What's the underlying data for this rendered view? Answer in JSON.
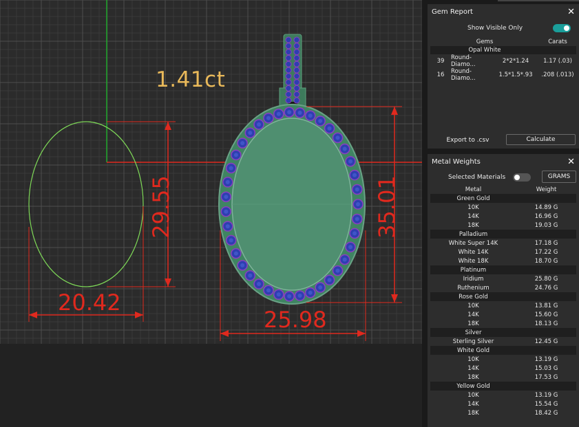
{
  "viewport": {
    "carat_label": "1.41ct",
    "dimensions": {
      "width_left": "20.42",
      "height_left": "29.55",
      "width_right": "25.98",
      "height_right": "35.01"
    }
  },
  "gem_report": {
    "title": "Gem Report",
    "close": "✕",
    "show_visible_label": "Show Visible Only",
    "show_visible_on": true,
    "columns": {
      "gems": "Gems",
      "carats": "Carats"
    },
    "group": "Opal White",
    "rows": [
      {
        "count": "39",
        "name": "Round-Diamo...",
        "size": "2*2*1.24",
        "carats": "1.17 (.03)"
      },
      {
        "count": "16",
        "name": "Round-Diamo...",
        "size": "1.5*1.5*.93",
        "carats": ".208 (.013)"
      }
    ],
    "export_label": "Export to .csv",
    "calculate_label": "Calculate"
  },
  "metal_weights": {
    "title": "Metal Weights",
    "close": "✕",
    "selected_materials_label": "Selected Materials",
    "selected_materials_on": false,
    "units_label": "GRAMS",
    "columns": {
      "metal": "Metal",
      "weight": "Weight"
    },
    "groups": [
      {
        "name": "Green Gold",
        "items": [
          {
            "metal": "10K",
            "weight": "14.89 G"
          },
          {
            "metal": "14K",
            "weight": "16.96 G"
          },
          {
            "metal": "18K",
            "weight": "19.03 G"
          }
        ]
      },
      {
        "name": "Palladium",
        "items": [
          {
            "metal": "White Super 14K",
            "weight": "17.18 G"
          },
          {
            "metal": "White 14K",
            "weight": "17.22 G"
          },
          {
            "metal": "White 18K",
            "weight": "18.70 G"
          }
        ]
      },
      {
        "name": "Platinum",
        "items": [
          {
            "metal": "Iridium",
            "weight": "25.80 G"
          },
          {
            "metal": "Ruthenium",
            "weight": "24.76 G"
          }
        ]
      },
      {
        "name": "Rose Gold",
        "items": [
          {
            "metal": "10K",
            "weight": "13.81 G"
          },
          {
            "metal": "14K",
            "weight": "15.60 G"
          },
          {
            "metal": "18K",
            "weight": "18.13 G"
          }
        ]
      },
      {
        "name": "Silver",
        "items": [
          {
            "metal": "Sterling Silver",
            "weight": "12.45 G"
          }
        ]
      },
      {
        "name": "White Gold",
        "items": [
          {
            "metal": "10K",
            "weight": "13.19 G"
          },
          {
            "metal": "14K",
            "weight": "15.03 G"
          },
          {
            "metal": "18K",
            "weight": "17.53 G"
          }
        ]
      },
      {
        "name": "Yellow Gold",
        "items": [
          {
            "metal": "10K",
            "weight": "13.19 G"
          },
          {
            "metal": "14K",
            "weight": "15.54 G"
          },
          {
            "metal": "18K",
            "weight": "18.42 G"
          }
        ]
      }
    ]
  },
  "colors": {
    "dimension": "#e0291e",
    "carat_label": "#e9b95a",
    "toggle_on": "#1a9e9a",
    "toggle_off": "#555555",
    "outline": "#7ed957",
    "pendant_fill": "#4f8f70",
    "gem_blue": "#2e3fb0"
  }
}
